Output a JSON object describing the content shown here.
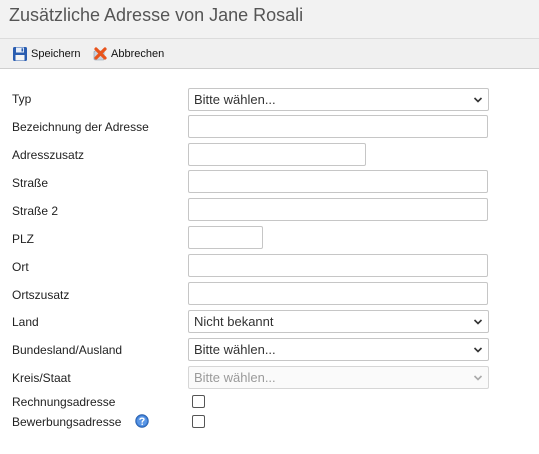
{
  "page": {
    "title": "Zusätzliche Adresse von Jane Rosali"
  },
  "toolbar": {
    "save_label": "Speichern",
    "cancel_label": "Abbrechen"
  },
  "form": {
    "typ": {
      "label": "Typ",
      "value": "Bitte wählen..."
    },
    "bezeichnung": {
      "label": "Bezeichnung der Adresse",
      "value": ""
    },
    "adresszusatz": {
      "label": "Adresszusatz",
      "value": ""
    },
    "strasse": {
      "label": "Straße",
      "value": ""
    },
    "strasse2": {
      "label": "Straße 2",
      "value": ""
    },
    "plz": {
      "label": "PLZ",
      "value": ""
    },
    "ort": {
      "label": "Ort",
      "value": ""
    },
    "ortszusatz": {
      "label": "Ortszusatz",
      "value": ""
    },
    "land": {
      "label": "Land",
      "value": "Nicht bekannt"
    },
    "bundesland": {
      "label": "Bundesland/Ausland",
      "value": "Bitte wählen..."
    },
    "kreis": {
      "label": "Kreis/Staat",
      "value": "Bitte wählen..."
    },
    "rechnungsadresse": {
      "label": "Rechnungsadresse",
      "checked": false
    },
    "bewerbungsadresse": {
      "label": "Bewerbungsadresse",
      "checked": false
    }
  },
  "icons": {
    "save": "floppy-disk-icon",
    "cancel": "cancel-x-icon",
    "help": "help-question-icon",
    "dropdown": "chevron-down-icon"
  },
  "colors": {
    "help_icon": "#3a7bd5",
    "save_icon": "#2a5db0",
    "cancel_icon": "#e8541c"
  }
}
